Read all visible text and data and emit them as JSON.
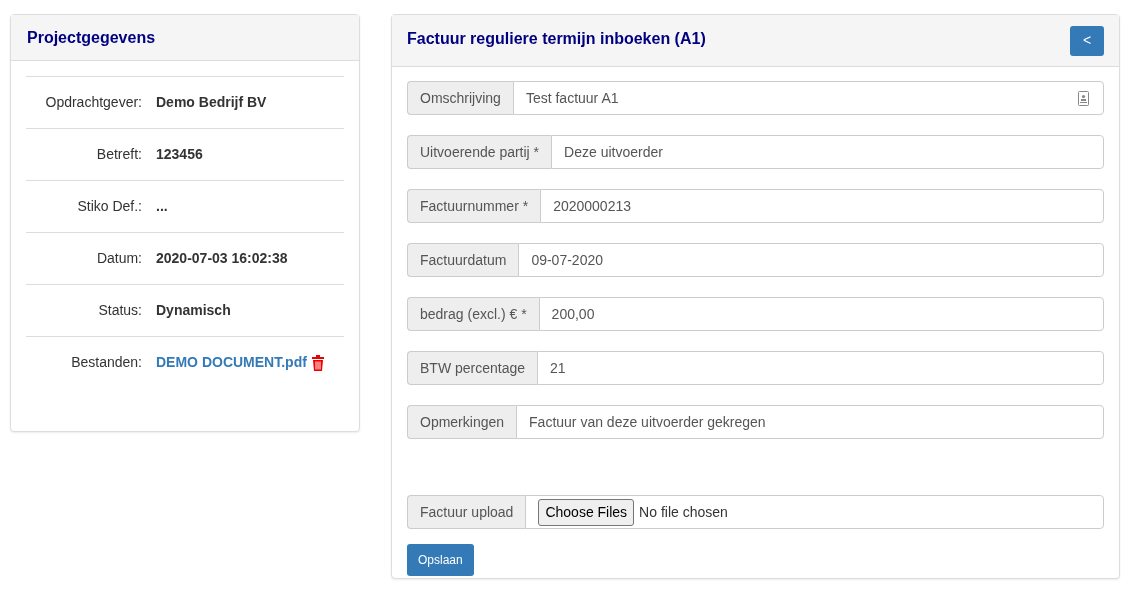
{
  "project_card": {
    "title": "Projectgegevens",
    "rows": [
      {
        "label": "Opdrachtgever:",
        "value": "Demo Bedrijf BV",
        "kind": "text"
      },
      {
        "label": "Betreft:",
        "value": "123456",
        "kind": "text"
      },
      {
        "label": "Stiko Def.:",
        "value": "...",
        "kind": "text"
      },
      {
        "label": "Datum:",
        "value": "2020-07-03 16:02:38",
        "kind": "text"
      },
      {
        "label": "Status:",
        "value": "Dynamisch",
        "kind": "text"
      },
      {
        "label": "Bestanden:",
        "value": "DEMO DOCUMENT.pdf",
        "kind": "file"
      }
    ]
  },
  "invoice_form": {
    "title": "Factuur reguliere termijn inboeken (A1)",
    "back_button": "<",
    "fields": [
      {
        "label": "Omschrijving",
        "value": "Test factuur A1",
        "kind": "text-with-icon"
      },
      {
        "label": "Uitvoerende partij *",
        "value": "Deze uitvoerder",
        "kind": "text"
      },
      {
        "label": "Factuurnummer *",
        "value": "2020000213",
        "kind": "text"
      },
      {
        "label": "Factuurdatum",
        "value": "09-07-2020",
        "kind": "text"
      },
      {
        "label": "bedrag (excl.) € *",
        "value": "200,00",
        "kind": "text"
      },
      {
        "label": "BTW percentage",
        "value": "21",
        "kind": "text"
      },
      {
        "label": "Opmerkingen",
        "value": "Factuur van deze uitvoerder gekregen",
        "kind": "text"
      },
      {
        "label": "Factuur upload",
        "button": "Choose Files",
        "value": "No file chosen",
        "kind": "file"
      }
    ],
    "submit_button": "Opslaan"
  }
}
